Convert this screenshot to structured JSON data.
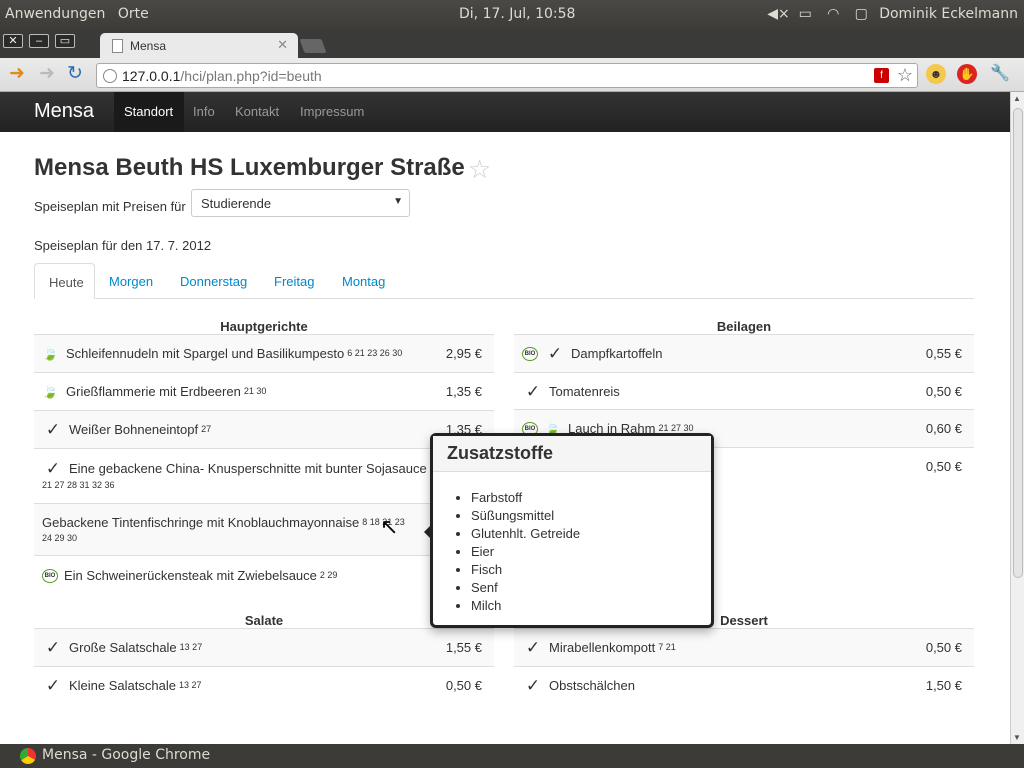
{
  "os": {
    "menu": [
      "Anwendungen",
      "Orte"
    ],
    "clock": "Di, 17. Jul, 10:58",
    "user": "Dominik Eckelmann"
  },
  "browser": {
    "tab_title": "Mensa",
    "url_host": "127.0.0.1",
    "url_path": "/hci/plan.php?id=beuth"
  },
  "navbar": {
    "brand": "Mensa",
    "items": [
      "Standort",
      "Info",
      "Kontakt",
      "Impressum"
    ]
  },
  "page": {
    "title": "Mensa Beuth HS Luxemburger Straße",
    "price_label": "Speiseplan mit Preisen für",
    "price_group": "Studierende",
    "date_line": "Speiseplan für den 17. 7. 2012"
  },
  "tabs": [
    "Heute",
    "Morgen",
    "Donnerstag",
    "Freitag",
    "Montag"
  ],
  "sections": {
    "hauptgerichte": {
      "title": "Hauptgerichte",
      "rows": [
        {
          "icon": "leaf",
          "name": "Schleifennudeln mit Spargel und Basilikumpesto",
          "add": "6 21 23 26 30",
          "price": "2,95 €"
        },
        {
          "icon": "leaf",
          "name": "Grießflammerie mit Erdbeeren",
          "add": "21 30",
          "price": "1,35 €"
        },
        {
          "icon": "vegan",
          "name": "Weißer Bohneneintopf",
          "add": "27",
          "price": "1,35 €"
        },
        {
          "icon": "vegan",
          "name": "Eine gebackene China- Knusperschnitte mit bunter Sojasauce",
          "add": "21 27 28 31 32 36",
          "price": ""
        },
        {
          "icon": "",
          "name": "Gebackene Tintenfischringe mit Knoblauchmayonnaise",
          "add": "8 18 21 23",
          "add2": "24 29 30",
          "price": ""
        },
        {
          "icon": "bio",
          "name": "Ein Schweinerückensteak mit Zwiebelsauce",
          "add": "2 29",
          "price": ""
        }
      ]
    },
    "beilagen": {
      "title": "Beilagen",
      "rows": [
        {
          "icon": "bio-vegan",
          "name": "Dampfkartoffeln",
          "add": "",
          "price": "0,55 €"
        },
        {
          "icon": "vegan",
          "name": "Tomatenreis",
          "add": "",
          "price": "0,50 €"
        },
        {
          "icon": "bio-leaf",
          "name": "Lauch in Rahm",
          "add": "21 27 30",
          "price": "0,60 €"
        },
        {
          "icon": "",
          "name": "",
          "add": "",
          "price": "0,50 €"
        }
      ]
    },
    "salate": {
      "title": "Salate",
      "rows": [
        {
          "icon": "vegan",
          "name": "Große Salatschale",
          "add": "13 27",
          "price": "1,55 €"
        },
        {
          "icon": "vegan",
          "name": "Kleine Salatschale",
          "add": "13 27",
          "price": "0,50 €"
        }
      ]
    },
    "dessert": {
      "title": "Dessert",
      "rows": [
        {
          "icon": "vegan",
          "name": "Mirabellenkompott",
          "add": "7 21",
          "price": "0,50 €"
        },
        {
          "icon": "vegan",
          "name": "Obstschälchen",
          "add": "",
          "price": "1,50 €"
        }
      ]
    }
  },
  "popover": {
    "title": "Zusatzstoffe",
    "items": [
      "Farbstoff",
      "Süßungsmittel",
      "Glutenhlt. Getreide",
      "Eier",
      "Fisch",
      "Senf",
      "Milch"
    ]
  },
  "taskbar": {
    "item": "Mensa - Google Chrome"
  },
  "colors": {
    "link": "#0088cc",
    "navbar": "#222222",
    "bio": "#5a9a2a"
  }
}
